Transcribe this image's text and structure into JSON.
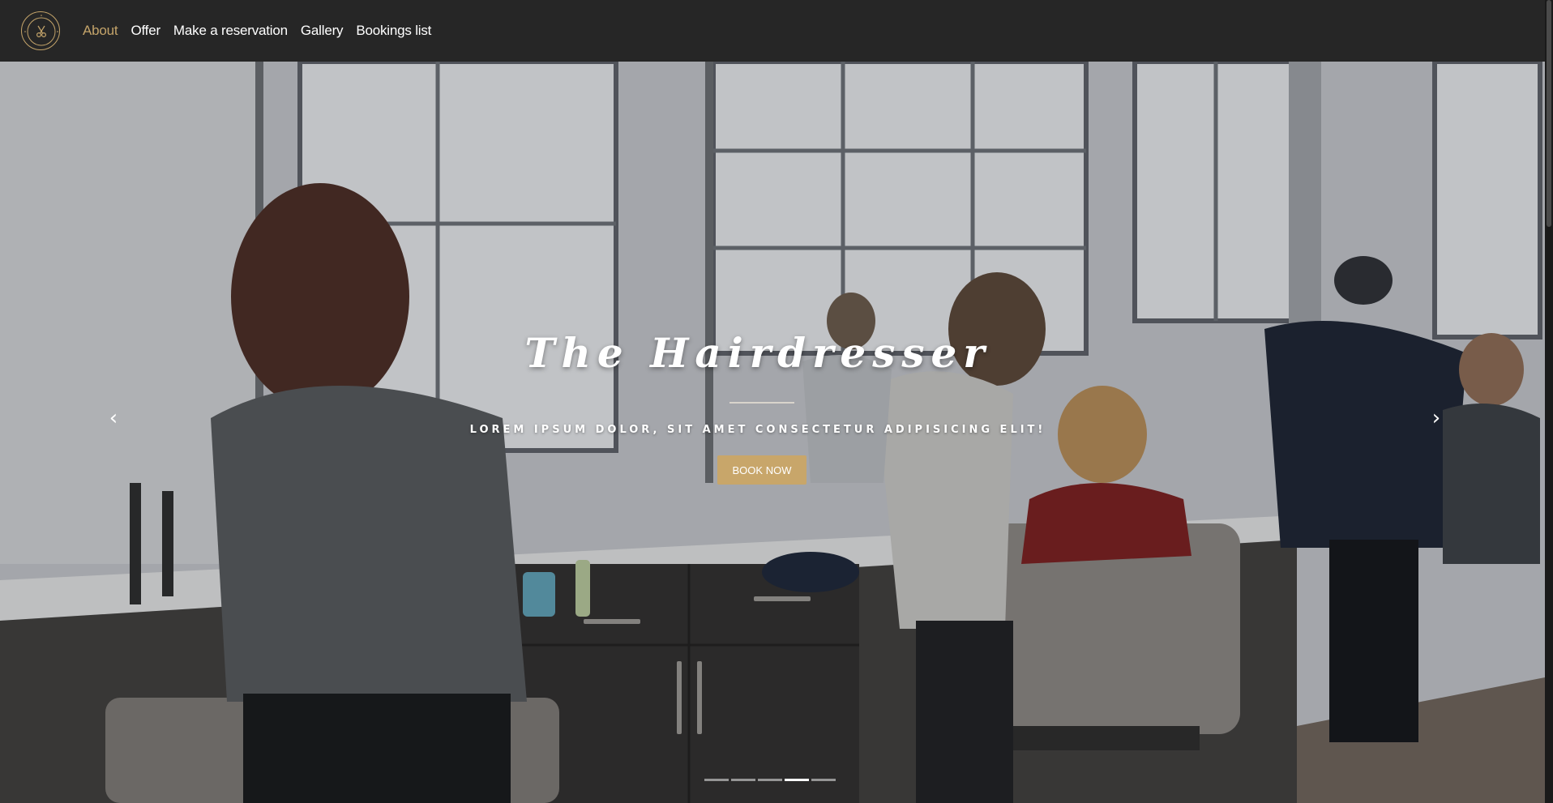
{
  "navbar": {
    "logo_text": "BEAUTY SALON",
    "links": [
      {
        "label": "About",
        "active": true
      },
      {
        "label": "Offer",
        "active": false
      },
      {
        "label": "Make a reservation",
        "active": false
      },
      {
        "label": "Gallery",
        "active": false
      },
      {
        "label": "Bookings list",
        "active": false
      }
    ]
  },
  "hero": {
    "title": "The Hairdresser",
    "subtitle": "LOREM IPSUM DOLOR, SIT AMET CONSECTETUR ADIPISICING ELIT!",
    "button_label": "BOOK NOW",
    "prev_icon": "chevron-left-icon",
    "next_icon": "chevron-right-icon",
    "slide_count": 5,
    "active_slide": 4
  },
  "colors": {
    "navbar_bg": "#262626",
    "accent": "#c4a46a",
    "button_bg": "#c8a66a",
    "nav_text": "#ffffff"
  }
}
